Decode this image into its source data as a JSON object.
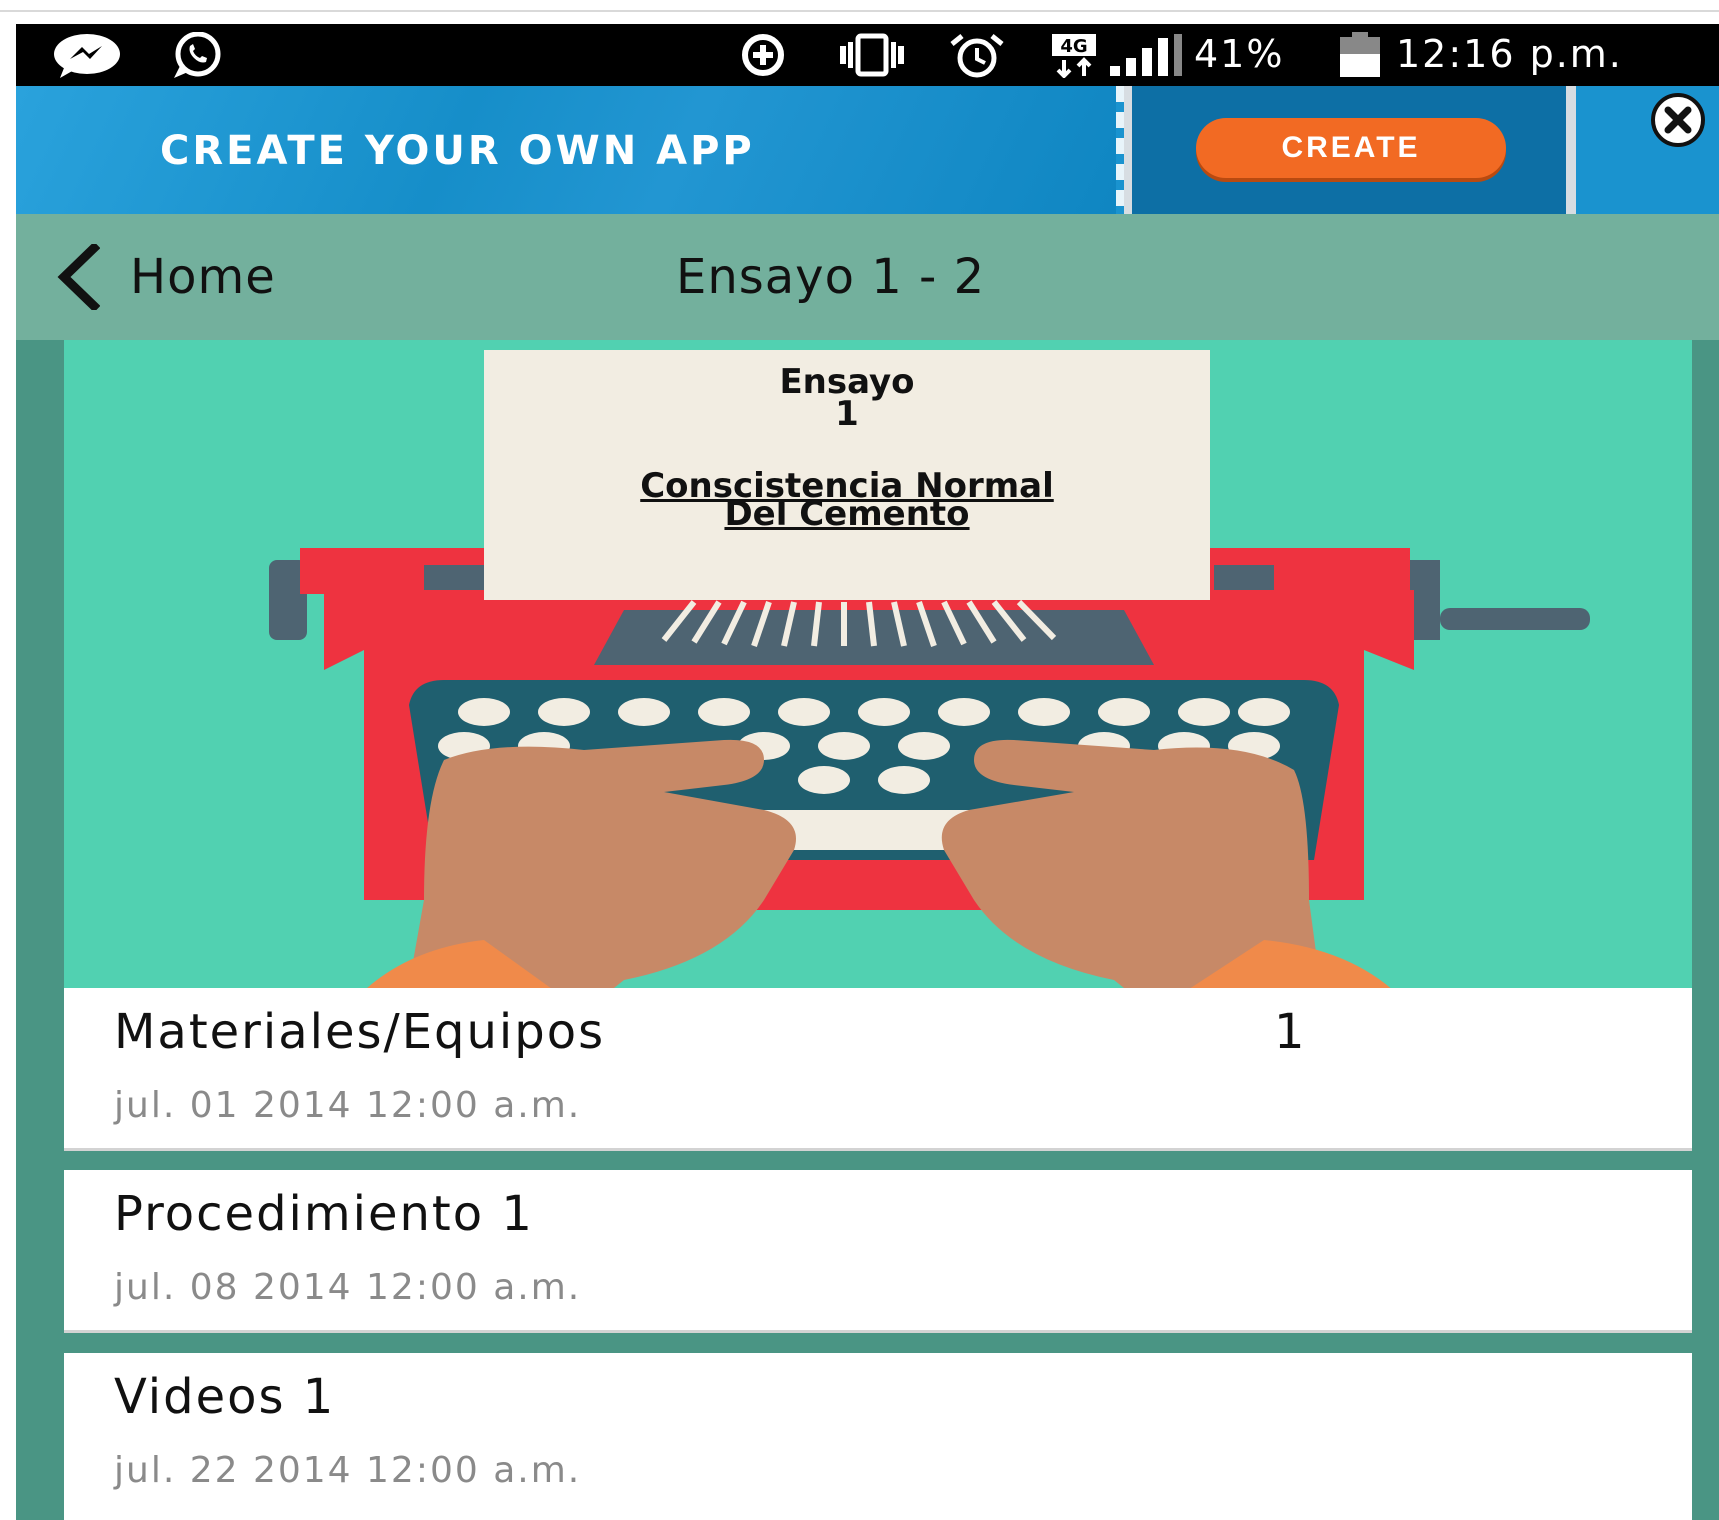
{
  "status_bar": {
    "left_icons": [
      "messenger-icon",
      "whatsapp-icon"
    ],
    "right_icons": [
      "data-saver-icon",
      "vibrate-icon",
      "alarm-icon",
      "4g-icon",
      "signal-icon"
    ],
    "battery_percent": "41%",
    "time": "12:16 p.m."
  },
  "ad": {
    "headline": "CREATE YOUR OWN APP",
    "button_label": "CREATE",
    "close_icon": "close-icon",
    "colors": {
      "banner": "#1a93cf",
      "button": "#f26a23"
    }
  },
  "nav": {
    "back_label": "Home",
    "title": "Ensayo 1 - 2"
  },
  "hero": {
    "paper_heading_line1": "Ensayo",
    "paper_heading_line2": "1",
    "paper_subtitle_line1": "Conscistencia Normal",
    "paper_subtitle_line2": "Del Cemento",
    "illustration": "typewriter-illustration"
  },
  "items": [
    {
      "title": "Materiales/Equipos",
      "badge": "1",
      "date": "jul. 01 2014 12:00 a.m."
    },
    {
      "title": "Procedimiento 1",
      "badge": "",
      "date": "jul. 08 2014 12:00 a.m."
    },
    {
      "title": "Videos 1",
      "badge": "",
      "date": "jul. 22 2014 12:00 a.m."
    }
  ],
  "colors": {
    "navbar": "#73b09d",
    "page_background": "#4a9584",
    "hero_background": "#51d1b1",
    "typewriter": "#ee3340"
  }
}
